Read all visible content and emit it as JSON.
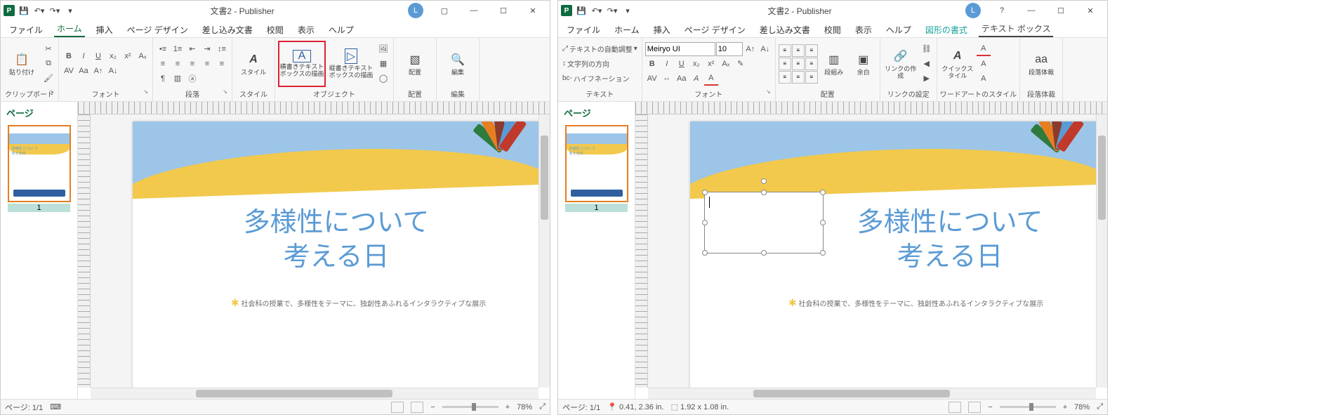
{
  "common": {
    "title": "文書2 - Publisher",
    "user_initial": "L",
    "menus": {
      "file": "ファイル",
      "home": "ホーム",
      "insert": "挿入",
      "page_design": "ページ デザイン",
      "mailings": "差し込み文書",
      "review": "校閲",
      "view": "表示",
      "help": "ヘルプ",
      "shape_format": "図形の書式",
      "text_box": "テキスト ボックス"
    },
    "pages_panel_title": "ページ",
    "page_number": "1",
    "doc": {
      "title_line1": "多様性について",
      "title_line2": "考える日",
      "body": "社会科の授業で、多様性をテーマに、独創性あふれるインタラクティブな展示",
      "thumb_line1": "多様性 につい て",
      "thumb_line2": "考える日"
    },
    "zoom": "78%"
  },
  "left": {
    "ribbon": {
      "clipboard": {
        "paste": "貼り付け",
        "label": "クリップボード"
      },
      "font_label": "フォント",
      "paragraph_label": "段落",
      "styles": {
        "btn": "スタイル",
        "label": "スタイル"
      },
      "objects": {
        "htext": "横書きテキスト\nボックスの描画",
        "vtext": "縦書きテキスト\nボックスの描画",
        "label": "オブジェクト"
      },
      "arrange": {
        "btn": "配置",
        "label": "配置"
      },
      "edit": {
        "btn": "編集",
        "label": "編集"
      }
    },
    "status": {
      "page": "ページ: 1/1"
    }
  },
  "right": {
    "ribbon": {
      "text": {
        "autofit": "テキストの自動調整",
        "direction": "文字列の方向",
        "hyphen": "ハイフネーション",
        "label": "テキスト"
      },
      "font": {
        "name": "Meiryo UI",
        "size": "10",
        "label": "フォント"
      },
      "align": {
        "columns": "段組み",
        "margins": "余白",
        "label": "配置"
      },
      "link": {
        "create": "リンクの作成",
        "label": "リンクの設定"
      },
      "wordart": {
        "quick": "クイックスタイル",
        "label": "ワードアートのスタイル"
      },
      "typo": {
        "dropcap": "段落体裁",
        "label": "段落体裁"
      }
    },
    "status": {
      "page": "ページ: 1/1",
      "pos": "0.41, 2.36 in.",
      "size": "1.92 x  1.08 in."
    }
  }
}
